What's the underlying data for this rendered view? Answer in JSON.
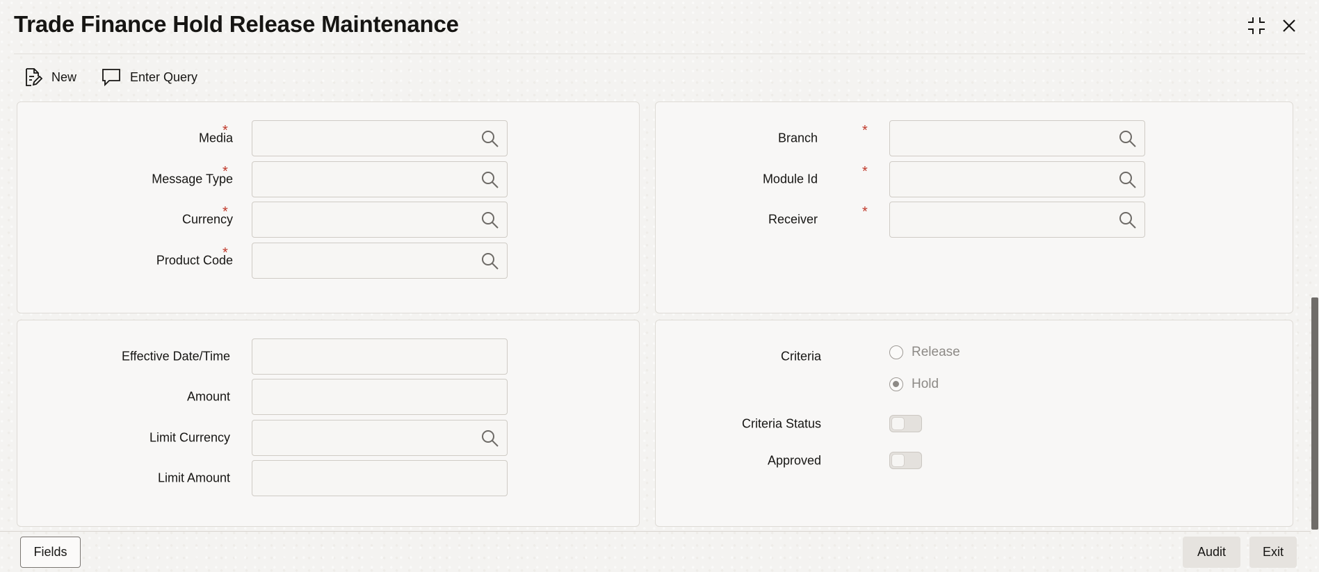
{
  "header": {
    "title": "Trade Finance Hold Release Maintenance",
    "minimize_icon": "collapse-icon",
    "close_icon": "close-icon"
  },
  "toolbar": {
    "new_label": "New",
    "new_icon": "new-document-icon",
    "enter_query_label": "Enter Query",
    "enter_query_icon": "chat-bubble-icon"
  },
  "main_left": {
    "media": {
      "label": "Media",
      "required": "*",
      "value": ""
    },
    "message_type": {
      "label": "Message Type",
      "required": "*",
      "value": ""
    },
    "currency": {
      "label": "Currency",
      "required": "*",
      "value": ""
    },
    "product_code": {
      "label": "Product Code",
      "required": "*",
      "value": ""
    }
  },
  "main_right": {
    "branch": {
      "label": "Branch",
      "required": "*",
      "value": ""
    },
    "module_id": {
      "label": "Module Id",
      "required": "*",
      "value": ""
    },
    "receiver": {
      "label": "Receiver",
      "required": "*",
      "value": ""
    }
  },
  "details_left": {
    "effective_datetime": {
      "label": "Effective Date/Time",
      "value": ""
    },
    "amount": {
      "label": "Amount",
      "value": ""
    },
    "limit_currency": {
      "label": "Limit Currency",
      "value": ""
    },
    "limit_amount": {
      "label": "Limit Amount",
      "value": ""
    }
  },
  "details_right": {
    "criteria": {
      "label": "Criteria",
      "options": [
        "Release",
        "Hold"
      ],
      "selected": "Hold"
    },
    "criteria_status": {
      "label": "Criteria Status",
      "on": false
    },
    "approved": {
      "label": "Approved",
      "on": false
    }
  },
  "footer": {
    "fields_label": "Fields",
    "audit_label": "Audit",
    "exit_label": "Exit"
  },
  "colors": {
    "required_asterisk": "#c0392b",
    "scroll_thumb": "#6f6c69"
  }
}
